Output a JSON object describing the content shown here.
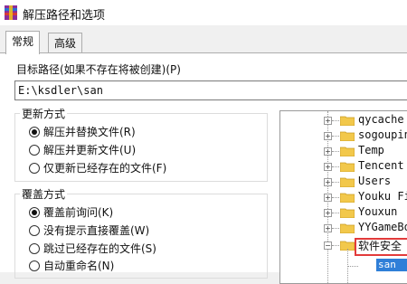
{
  "window": {
    "title": "解压路径和选项"
  },
  "tabs": [
    {
      "label": "常规"
    },
    {
      "label": "高级"
    }
  ],
  "target_path": {
    "label": "目标路径(如果不存在将被创建)(P)",
    "value": "E:\\ksdler\\san"
  },
  "update_mode": {
    "title": "更新方式",
    "options": [
      {
        "label": "解压并替换文件(R)",
        "checked": true
      },
      {
        "label": "解压并更新文件(U)",
        "checked": false
      },
      {
        "label": "仅更新已经存在的文件(F)",
        "checked": false
      }
    ]
  },
  "overwrite_mode": {
    "title": "覆盖方式",
    "options": [
      {
        "label": "覆盖前询问(K)",
        "checked": true
      },
      {
        "label": "没有提示直接覆盖(W)",
        "checked": false
      },
      {
        "label": "跳过已经存在的文件(S)",
        "checked": false
      },
      {
        "label": "自动重命名(N)",
        "checked": false
      }
    ]
  },
  "folder_tree": {
    "items": [
      {
        "label": "qycache"
      },
      {
        "label": "sogoupin"
      },
      {
        "label": "Temp"
      },
      {
        "label": "Tencent"
      },
      {
        "label": "Users"
      },
      {
        "label": "Youku Fi"
      },
      {
        "label": "Youxun"
      },
      {
        "label": "YYGameBo"
      },
      {
        "label": "软件安全"
      }
    ],
    "selected": "san"
  },
  "colors": {
    "highlight_border": "#e23b3b",
    "selection": "#2f7fd8"
  }
}
